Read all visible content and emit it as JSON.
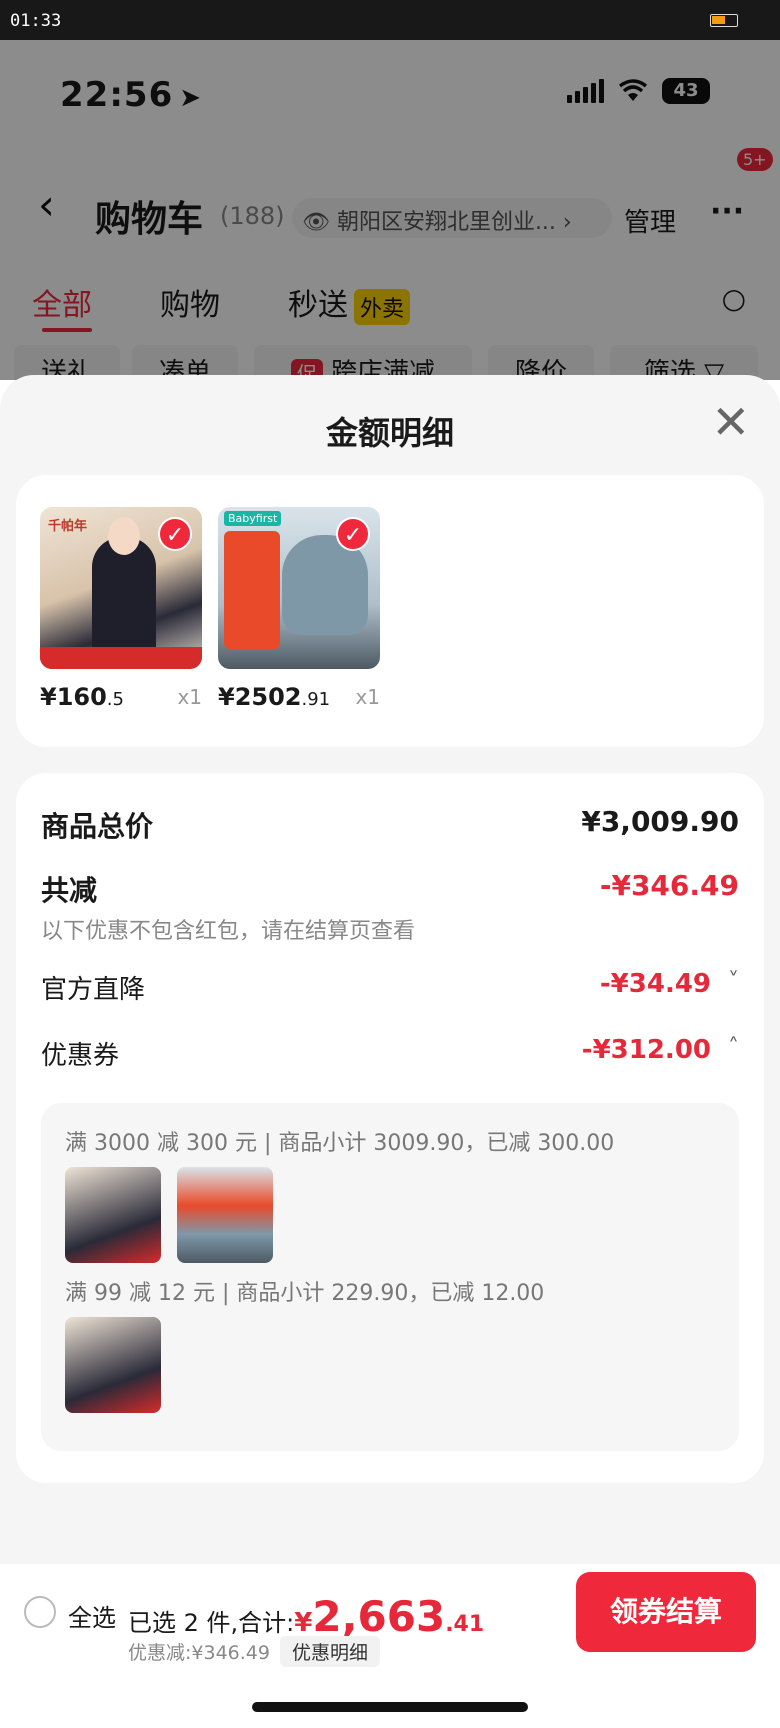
{
  "system_bar": {
    "time": "01:33"
  },
  "ios_status": {
    "time": "22:56",
    "battery": "43"
  },
  "nav": {
    "title": "购物车",
    "count": "(188)",
    "address": "朝阳区安翔北里创业...",
    "manage": "管理",
    "more": "···",
    "badge": "5+"
  },
  "tabs": [
    {
      "label": "全部"
    },
    {
      "label": "购物"
    },
    {
      "label": "秒送"
    }
  ],
  "takeout_badge": "外卖",
  "chips": {
    "gift": "送礼",
    "bundle": "凑单",
    "promo_tag": "促",
    "cross_store": "跨店满减",
    "price_drop": "降价",
    "filter": "筛选"
  },
  "sheet": {
    "title": "金额明细",
    "products": [
      {
        "price_int": "¥160",
        "price_dec": ".5",
        "qty": "x1",
        "brand": "千帕年"
      },
      {
        "price_int": "¥2502",
        "price_dec": ".91",
        "qty": "x1",
        "brand": "Babyfirst"
      }
    ],
    "summary": {
      "total_label": "商品总价",
      "total_value": "¥3,009.90",
      "reduce_label": "共减",
      "reduce_value": "-¥346.49",
      "note": "以下优惠不包含红包，请在结算页查看",
      "official_label": "官方直降",
      "official_value": "-¥34.49",
      "coupon_label": "优惠券",
      "coupon_value": "-¥312.00"
    },
    "coupons": [
      {
        "line": "满 3000 减 300 元 | 商品小计 3009.90，已减 300.00"
      },
      {
        "line": "满 99 减 12 元 | 商品小计 229.90，已减 12.00"
      }
    ]
  },
  "bottom": {
    "select_all": "全选",
    "selected": "已选 2 件,合计:",
    "yen": "¥",
    "total_int": "2,663",
    "total_dec": ".41",
    "discount": "优惠减:¥346.49",
    "detail": "优惠明细",
    "pay": "领券结算"
  },
  "colors": {
    "accent": "#f0283c",
    "sheet_bg": "#f5f5f5"
  }
}
